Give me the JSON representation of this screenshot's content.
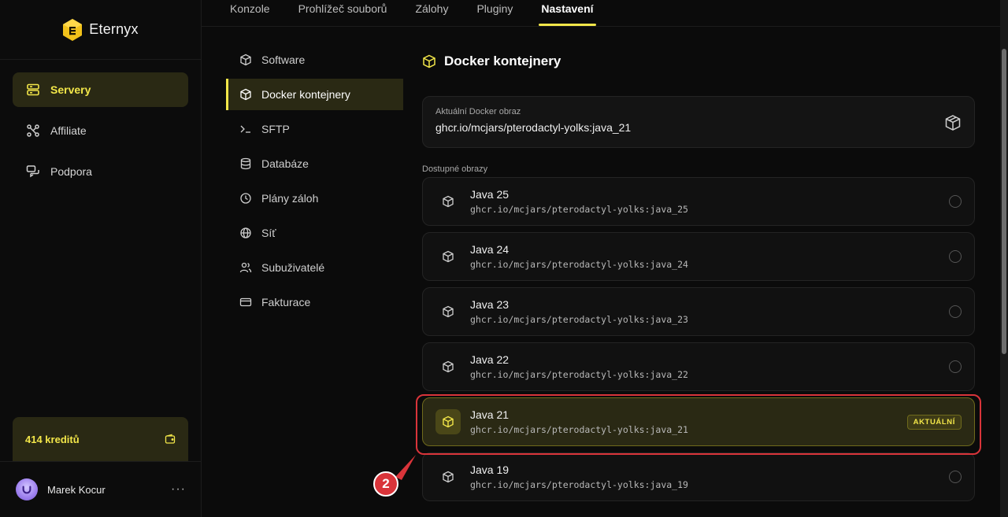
{
  "brand": {
    "name": "Eternyx",
    "accent": "#f2e649"
  },
  "sidebar": {
    "items": [
      {
        "label": "Servery",
        "icon": "server-icon",
        "active": true
      },
      {
        "label": "Affiliate",
        "icon": "network-icon",
        "active": false
      },
      {
        "label": "Podpora",
        "icon": "chat-icon",
        "active": false
      }
    ],
    "credits": "414 kreditů",
    "user": {
      "name": "Marek Kocur",
      "more": "···"
    }
  },
  "tabs": [
    {
      "label": "Konzole",
      "active": false
    },
    {
      "label": "Prohlížeč souborů",
      "active": false
    },
    {
      "label": "Zálohy",
      "active": false
    },
    {
      "label": "Pluginy",
      "active": false
    },
    {
      "label": "Nastavení",
      "active": true
    }
  ],
  "settings_nav": [
    {
      "label": "Software",
      "icon": "box-icon",
      "active": false
    },
    {
      "label": "Docker kontejnery",
      "icon": "container-icon",
      "active": true
    },
    {
      "label": "SFTP",
      "icon": "terminal-icon",
      "active": false
    },
    {
      "label": "Databáze",
      "icon": "database-icon",
      "active": false
    },
    {
      "label": "Plány záloh",
      "icon": "clock-icon",
      "active": false
    },
    {
      "label": "Síť",
      "icon": "globe-icon",
      "active": false
    },
    {
      "label": "Subuživatelé",
      "icon": "users-icon",
      "active": false
    },
    {
      "label": "Fakturace",
      "icon": "card-icon",
      "active": false
    }
  ],
  "main": {
    "title": "Docker kontejnery",
    "current": {
      "label": "Aktuální Docker obraz",
      "value": "ghcr.io/mcjars/pterodactyl-yolks:java_21"
    },
    "available_label": "Dostupné obrazy",
    "images": [
      {
        "name": "Java 25",
        "ref": "ghcr.io/mcjars/pterodactyl-yolks:java_25",
        "active": false
      },
      {
        "name": "Java 24",
        "ref": "ghcr.io/mcjars/pterodactyl-yolks:java_24",
        "active": false
      },
      {
        "name": "Java 23",
        "ref": "ghcr.io/mcjars/pterodactyl-yolks:java_23",
        "active": false
      },
      {
        "name": "Java 22",
        "ref": "ghcr.io/mcjars/pterodactyl-yolks:java_22",
        "active": false
      },
      {
        "name": "Java 21",
        "ref": "ghcr.io/mcjars/pterodactyl-yolks:java_21",
        "active": true,
        "badge": "AKTUÁLNÍ"
      },
      {
        "name": "Java 19",
        "ref": "ghcr.io/mcjars/pterodactyl-yolks:java_19",
        "active": false
      }
    ]
  },
  "annotation": {
    "number": "2",
    "color": "#d9343a"
  }
}
